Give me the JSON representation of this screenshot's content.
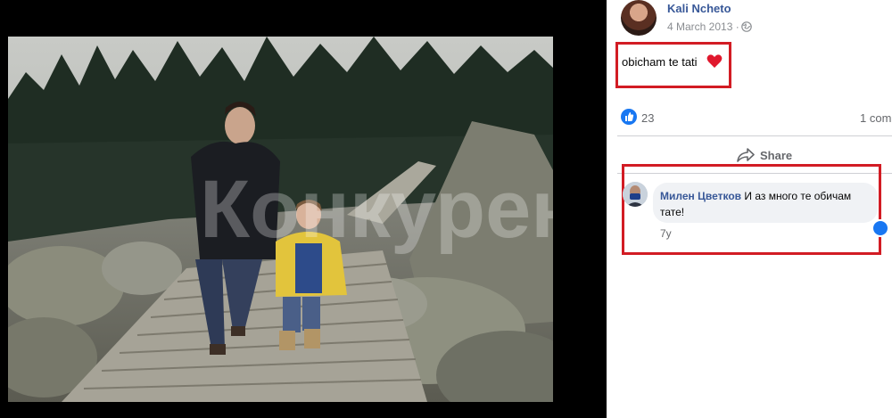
{
  "photo": {
    "watermark": "Конкурент",
    "description_icon": "photo"
  },
  "post": {
    "author": "Kali Ncheto",
    "date": "4 March 2013 ·",
    "text": "obicham te tati",
    "reactions_count": "23",
    "comments_count": "1 com",
    "share_label": "Share"
  },
  "comment": {
    "author": "Милен Цветков",
    "text": "И аз много те обичам тате!",
    "time": "7y"
  },
  "colors": {
    "highlight": "#d21c24",
    "link": "#385898",
    "facebook_blue": "#1877f2"
  }
}
